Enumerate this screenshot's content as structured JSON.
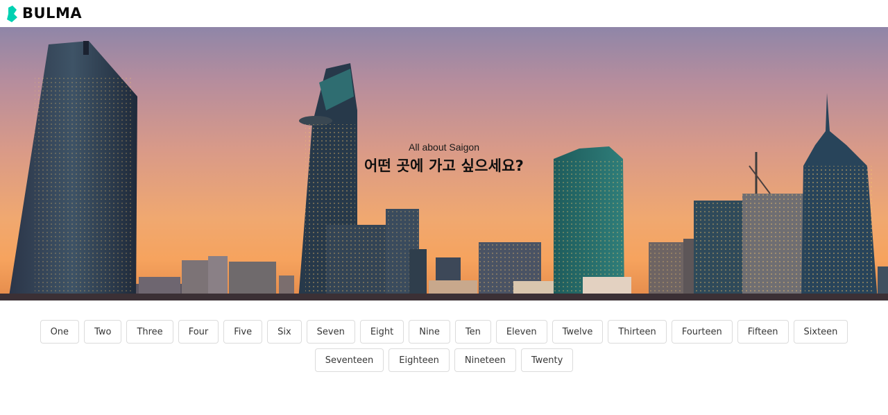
{
  "navbar": {
    "brand_text": "BULMA",
    "brand_icon": "bulma-logo-icon",
    "brand_color": "#00d1b2"
  },
  "hero": {
    "subtitle": "All about Saigon",
    "title": "어떤 곳에 가고 싶으세요?"
  },
  "tags": [
    "One",
    "Two",
    "Three",
    "Four",
    "Five",
    "Six",
    "Seven",
    "Eight",
    "Nine",
    "Ten",
    "Eleven",
    "Twelve",
    "Thirteen",
    "Fourteen",
    "Fifteen",
    "Sixteen",
    "Seventeen",
    "Eighteen",
    "Nineteen",
    "Twenty"
  ]
}
